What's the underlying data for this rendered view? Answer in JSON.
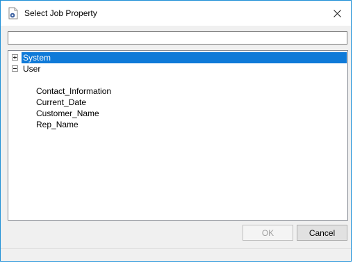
{
  "window": {
    "title": "Select Job Property",
    "title_icon": "document-gear-icon",
    "close_icon": "close-icon"
  },
  "search": {
    "value": "",
    "placeholder": ""
  },
  "tree": {
    "nodes": [
      {
        "label": "System",
        "state": "collapsed",
        "selected": true,
        "children": []
      },
      {
        "label": "User",
        "state": "expanded",
        "selected": false,
        "children": [
          "Contact_Information",
          "Current_Date",
          "Customer_Name",
          "Rep_Name"
        ]
      }
    ]
  },
  "buttons": {
    "ok_label": "OK",
    "ok_enabled": false,
    "cancel_label": "Cancel"
  },
  "colors": {
    "selection": "#0f7ad8",
    "window_border": "#1e8fd6"
  }
}
